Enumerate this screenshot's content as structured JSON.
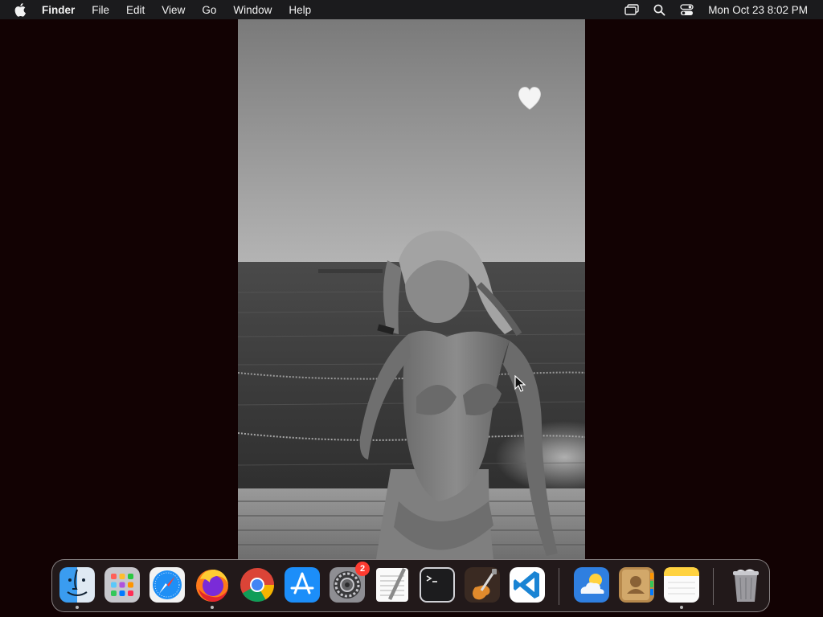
{
  "menubar": {
    "app_name": "Finder",
    "menus": [
      "File",
      "Edit",
      "View",
      "Go",
      "Window",
      "Help"
    ],
    "clock": "Mon Oct 23  8:02 PM",
    "status_icons": [
      "screen-mirroring-icon",
      "spotlight-search-icon",
      "control-center-icon"
    ]
  },
  "photo": {
    "content": "black-and-white photo",
    "sticker": "white-heart-icon"
  },
  "dock": {
    "apps": [
      {
        "id": "finder",
        "running": true
      },
      {
        "id": "launchpad",
        "running": false
      },
      {
        "id": "safari",
        "running": false
      },
      {
        "id": "firefox",
        "running": true
      },
      {
        "id": "chrome",
        "running": false
      },
      {
        "id": "app-store",
        "running": false
      },
      {
        "id": "system-settings",
        "running": false,
        "badge": "2"
      },
      {
        "id": "textedit",
        "running": false
      },
      {
        "id": "terminal",
        "running": false
      },
      {
        "id": "garageband",
        "running": false
      },
      {
        "id": "vscode",
        "running": false
      },
      {
        "id": "weather",
        "running": false
      },
      {
        "id": "contacts",
        "running": false
      },
      {
        "id": "notes",
        "running": true
      },
      {
        "id": "trash",
        "running": false
      }
    ]
  },
  "colors": {
    "desktop": "#120203",
    "menubar": "#1b1b1d",
    "badge": "#ff3b30"
  }
}
